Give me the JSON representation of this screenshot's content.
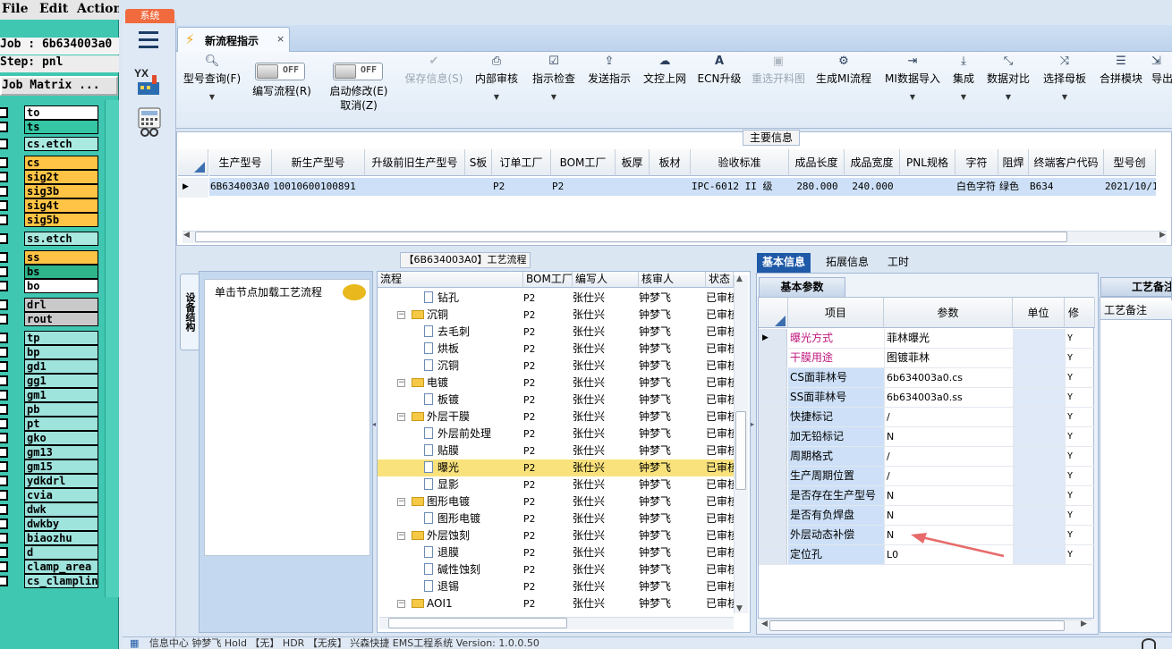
{
  "left_panel": {
    "menu": {
      "file": "File",
      "edit": "Edit",
      "actions": "Actions"
    },
    "job_line": "Job : 6b634003a0",
    "step_line": "Step: pnl",
    "matrix_button": "Job Matrix ...",
    "layers": [
      {
        "name": "to",
        "color": "white"
      },
      {
        "name": "ts",
        "color": "teal"
      },
      {
        "name": "cs.etch",
        "color": "cyan"
      },
      {
        "name": "cs",
        "color": "orange"
      },
      {
        "name": "sig2t",
        "color": "orange"
      },
      {
        "name": "sig3b",
        "color": "orange"
      },
      {
        "name": "sig4t",
        "color": "orange"
      },
      {
        "name": "sig5b",
        "color": "orange"
      },
      {
        "name": "ss.etch",
        "color": "cyan"
      },
      {
        "name": "ss",
        "color": "orange"
      },
      {
        "name": "bs",
        "color": "green"
      },
      {
        "name": "bo",
        "color": "white"
      },
      {
        "name": "drl",
        "color": "gray"
      },
      {
        "name": "rout",
        "color": "gray"
      },
      {
        "name": "tp",
        "color": "lt"
      },
      {
        "name": "bp",
        "color": "lt"
      },
      {
        "name": "gd1",
        "color": "lt"
      },
      {
        "name": "gg1",
        "color": "lt"
      },
      {
        "name": "gm1",
        "color": "lt"
      },
      {
        "name": "pb",
        "color": "lt"
      },
      {
        "name": "pt",
        "color": "lt"
      },
      {
        "name": "gko",
        "color": "lt"
      },
      {
        "name": "gm13",
        "color": "lt"
      },
      {
        "name": "gm15",
        "color": "lt"
      },
      {
        "name": "ydkdrl",
        "color": "lt"
      },
      {
        "name": "cvia",
        "color": "lt"
      },
      {
        "name": "dwk",
        "color": "lt"
      },
      {
        "name": "dwkby",
        "color": "lt"
      },
      {
        "name": "biaozhu",
        "color": "lt"
      },
      {
        "name": "d",
        "color": "lt"
      },
      {
        "name": "clamp_area",
        "color": "lt"
      },
      {
        "name": "cs_clampline",
        "color": "lt"
      }
    ]
  },
  "nav": {
    "system_tab": "系统"
  },
  "tabs": {
    "active_tab": "新流程指示",
    "close": "×"
  },
  "toolbar": {
    "query": "型号查询(F)",
    "edit_flow": "编写流程(R)",
    "start_modify": "启动修改(E)",
    "cancel": "取消(Z)",
    "toggle_off": "OFF",
    "save": "保存信息(S)",
    "internal_review": "内部审核",
    "instr_check": "指示检查",
    "send_instr": "发送指示",
    "upload": "文控上网",
    "ecn": "ECN升级",
    "regen": "重选开料图",
    "gen_mi": "生成MI流程",
    "mi_import": "MI数据导入",
    "integrate": "集成",
    "compare": "数据对比",
    "select_mother": "选择母板",
    "merge": "合拼模块",
    "export": "导出"
  },
  "main_info": {
    "caption": "主要信息",
    "headers": [
      "生产型号",
      "新生产型号",
      "升级前旧生产型号",
      "S板",
      "订单工厂",
      "BOM工厂",
      "板厚",
      "板材",
      "验收标准",
      "成品长度",
      "成品宽度",
      "PNL规格",
      "字符",
      "阻焊",
      "终端客户代码",
      "型号创"
    ],
    "row": [
      "6B634003A0",
      "10010600100891",
      "",
      "",
      "P2",
      "P2",
      "",
      "",
      "IPC-6012 II 级",
      "280.000",
      "240.000",
      "",
      "白色字符",
      "绿色",
      "B634",
      "2021/10/1"
    ]
  },
  "left_tree_panel": {
    "vertical_tab": "设备结构",
    "hint": "单击节点加载工艺流程"
  },
  "process": {
    "caption": "【6B634003A0】工艺流程",
    "headers": [
      "流程",
      "BOM工厂",
      "编写人",
      "核审人",
      "状态"
    ],
    "rows": [
      {
        "name": "钻孔",
        "level": 2,
        "type": "doc",
        "bom": "P2",
        "writer": "张仕兴",
        "reviewer": "钟梦飞",
        "status": "已审核"
      },
      {
        "name": "沉铜",
        "level": 1,
        "type": "folder",
        "bom": "P2",
        "writer": "张仕兴",
        "reviewer": "钟梦飞",
        "status": "已审核"
      },
      {
        "name": "去毛刺",
        "level": 2,
        "type": "doc",
        "bom": "P2",
        "writer": "张仕兴",
        "reviewer": "钟梦飞",
        "status": "已审核"
      },
      {
        "name": "烘板",
        "level": 2,
        "type": "doc",
        "bom": "P2",
        "writer": "张仕兴",
        "reviewer": "钟梦飞",
        "status": "已审核"
      },
      {
        "name": "沉铜",
        "level": 2,
        "type": "doc",
        "bom": "P2",
        "writer": "张仕兴",
        "reviewer": "钟梦飞",
        "status": "已审核"
      },
      {
        "name": "电镀",
        "level": 1,
        "type": "folder",
        "bom": "P2",
        "writer": "张仕兴",
        "reviewer": "钟梦飞",
        "status": "已审核"
      },
      {
        "name": "板镀",
        "level": 2,
        "type": "doc",
        "bom": "P2",
        "writer": "张仕兴",
        "reviewer": "钟梦飞",
        "status": "已审核"
      },
      {
        "name": "外层干膜",
        "level": 1,
        "type": "folder",
        "bom": "P2",
        "writer": "张仕兴",
        "reviewer": "钟梦飞",
        "status": "已审核"
      },
      {
        "name": "外层前处理",
        "level": 2,
        "type": "doc",
        "bom": "P2",
        "writer": "张仕兴",
        "reviewer": "钟梦飞",
        "status": "已审核"
      },
      {
        "name": "贴膜",
        "level": 2,
        "type": "doc",
        "bom": "P2",
        "writer": "张仕兴",
        "reviewer": "钟梦飞",
        "status": "已审核"
      },
      {
        "name": "曝光",
        "level": 2,
        "type": "doc",
        "bom": "P2",
        "writer": "张仕兴",
        "reviewer": "钟梦飞",
        "status": "已审核",
        "selected": true
      },
      {
        "name": "显影",
        "level": 2,
        "type": "doc",
        "bom": "P2",
        "writer": "张仕兴",
        "reviewer": "钟梦飞",
        "status": "已审核"
      },
      {
        "name": "图形电镀",
        "level": 1,
        "type": "folder",
        "bom": "P2",
        "writer": "张仕兴",
        "reviewer": "钟梦飞",
        "status": "已审核"
      },
      {
        "name": "图形电镀",
        "level": 2,
        "type": "doc",
        "bom": "P2",
        "writer": "张仕兴",
        "reviewer": "钟梦飞",
        "status": "已审核"
      },
      {
        "name": "外层蚀刻",
        "level": 1,
        "type": "folder",
        "bom": "P2",
        "writer": "张仕兴",
        "reviewer": "钟梦飞",
        "status": "已审核"
      },
      {
        "name": "退膜",
        "level": 2,
        "type": "doc",
        "bom": "P2",
        "writer": "张仕兴",
        "reviewer": "钟梦飞",
        "status": "已审核"
      },
      {
        "name": "碱性蚀刻",
        "level": 2,
        "type": "doc",
        "bom": "P2",
        "writer": "张仕兴",
        "reviewer": "钟梦飞",
        "status": "已审核"
      },
      {
        "name": "退锡",
        "level": 2,
        "type": "doc",
        "bom": "P2",
        "writer": "张仕兴",
        "reviewer": "钟梦飞",
        "status": "已审核"
      },
      {
        "name": "AOI1",
        "level": 1,
        "type": "folder",
        "bom": "P2",
        "writer": "张仕兴",
        "reviewer": "钟梦飞",
        "status": "已审核"
      }
    ]
  },
  "right_panel": {
    "tabs": [
      "基本信息",
      "拓展信息",
      "工时"
    ],
    "subtab": "基本参数",
    "headers": [
      "项目",
      "参数",
      "单位",
      "修"
    ],
    "rows": [
      {
        "item": "曝光方式",
        "value": "菲林曝光",
        "mod": "Y",
        "highlight": true
      },
      {
        "item": "干膜用途",
        "value": "图镀菲林",
        "mod": "Y",
        "highlight": true
      },
      {
        "item": "CS面菲林号",
        "value": "6b634003a0.cs",
        "mod": "Y"
      },
      {
        "item": "SS面菲林号",
        "value": "6b634003a0.ss",
        "mod": "Y"
      },
      {
        "item": "快捷标记",
        "value": "/",
        "mod": "Y"
      },
      {
        "item": "加无铅标记",
        "value": "N",
        "mod": "Y"
      },
      {
        "item": "周期格式",
        "value": "/",
        "mod": "Y"
      },
      {
        "item": "生产周期位置",
        "value": "/",
        "mod": "Y"
      },
      {
        "item": "是否存在生产型号",
        "value": "N",
        "mod": "Y"
      },
      {
        "item": "是否有负焊盘",
        "value": "N",
        "mod": "Y"
      },
      {
        "item": "外层动态补偿",
        "value": "N",
        "mod": "Y"
      },
      {
        "item": "定位孔",
        "value": "L0",
        "mod": "Y"
      }
    ],
    "remark_tab": "工艺备注",
    "remark_header": "工艺备注"
  },
  "status_bar": {
    "text": "信息中心    钟梦飞        Hold 【无】 HDR 【无疾】      兴森快捷  EMS工程系统  Version: 1.0.0.50"
  },
  "colors": {
    "accent": "#1f5aa8",
    "selected_row": "#f9e27c",
    "highlight_text": "#c0197e",
    "arrow": "#e86a6a"
  }
}
